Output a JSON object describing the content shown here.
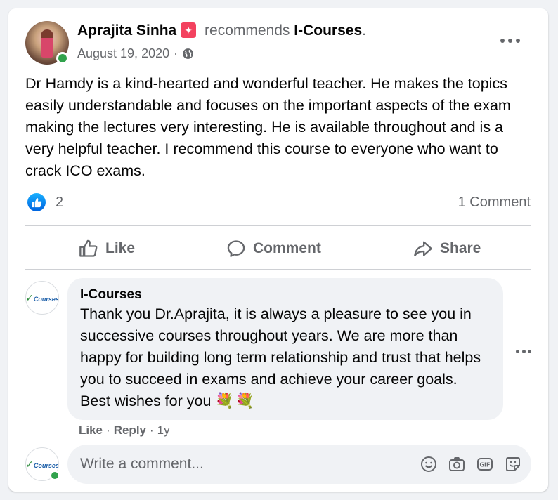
{
  "post": {
    "author": "Aprajita Sinha",
    "recommends_text": "recommends",
    "page_name": "I-Courses",
    "period": ".",
    "date": "August 19, 2020",
    "separator": "·",
    "privacy_icon": "globe-icon",
    "text": "Dr Hamdy is a kind-hearted and wonderful teacher. He makes the topics easily understandable and focuses on the important aspects of the exam making the lectures very interesting. He is available throughout and is a very helpful teacher. I recommend this course to everyone who want to crack ICO exams.",
    "reaction_count": "2",
    "comment_count": "1 Comment"
  },
  "actions": {
    "like": "Like",
    "comment": "Comment",
    "share": "Share"
  },
  "comment": {
    "author": "I-Courses",
    "text": "Thank you Dr.Aprajita, it is always a pleasure to see you in successive courses throughout years. We are more than happy for building long term relationship and trust that helps you to succeed in exams and achieve your career goals. Best wishes for you",
    "emoji": "💐💐",
    "like_label": "Like",
    "reply_label": "Reply",
    "dot": "·",
    "time": "1y",
    "avatar_logo": "Courses"
  },
  "composer": {
    "placeholder": "Write a comment..."
  },
  "colors": {
    "online": "#31a24c",
    "like_blue": "#0062df",
    "star_badge": "#f3425f",
    "muted_text": "#65676b"
  }
}
